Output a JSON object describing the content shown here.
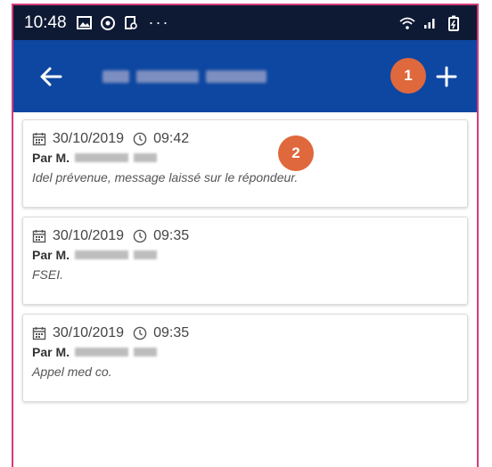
{
  "status_bar": {
    "time": "10:48",
    "dots": "···"
  },
  "app_bar": {
    "back_icon": "arrow-left-icon",
    "add_icon": "plus-icon"
  },
  "badges": {
    "one": "1",
    "two": "2"
  },
  "entries": [
    {
      "date": "30/10/2019",
      "time": "09:42",
      "author_prefix": "Par M.",
      "note": "Idel prévenue, message laissé sur le répondeur."
    },
    {
      "date": "30/10/2019",
      "time": "09:35",
      "author_prefix": "Par M.",
      "note": "FSEI."
    },
    {
      "date": "30/10/2019",
      "time": "09:35",
      "author_prefix": "Par M.",
      "note": "Appel med co."
    }
  ],
  "colors": {
    "app_bar": "#0e47a1",
    "status_bar": "#0e1a34",
    "badge": "#e0683d",
    "frame": "#d63a7a"
  }
}
